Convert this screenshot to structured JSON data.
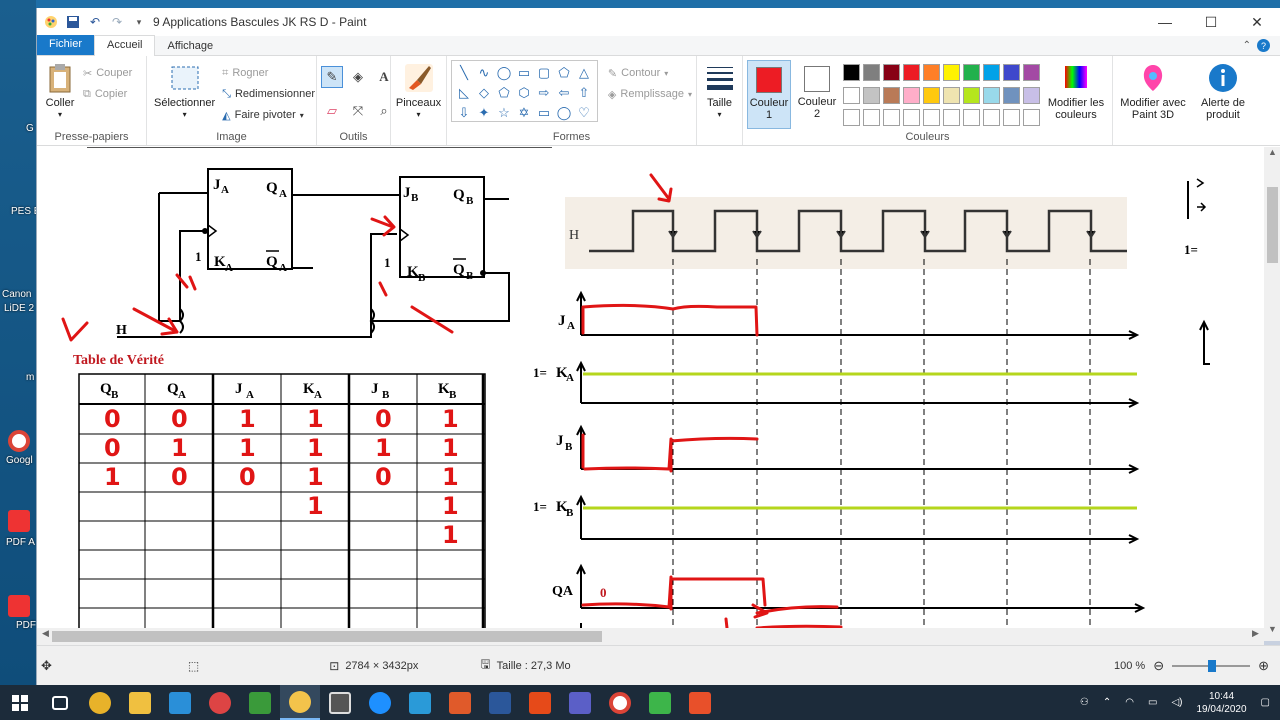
{
  "desktop": {
    "labels": [
      "G",
      "PES E",
      "Canon",
      "LiDE 2",
      "m",
      "Googl",
      "PDF A",
      "PDF"
    ]
  },
  "window": {
    "title": "9 Applications Bascules JK RS D - Paint",
    "controls": {
      "minimize": "—",
      "maximize": "☐",
      "close": "✕"
    }
  },
  "tabs": {
    "file": "Fichier",
    "home": "Accueil",
    "view": "Affichage"
  },
  "ribbon": {
    "clipboard": {
      "label": "Presse-papiers",
      "paste": "Coller",
      "cut": "Couper",
      "copy": "Copier"
    },
    "image": {
      "label": "Image",
      "select": "Sélectionner",
      "crop": "Rogner",
      "resize": "Redimensionner",
      "rotate": "Faire pivoter"
    },
    "tools": {
      "label": "Outils"
    },
    "brushes": {
      "label": "Pinceaux"
    },
    "shapes": {
      "label": "Formes",
      "outline": "Contour",
      "fill": "Remplissage"
    },
    "size": {
      "label": "Taille"
    },
    "colors": {
      "label": "Couleurs",
      "color1": "Couleur 1",
      "color2": "Couleur 2",
      "edit": "Modifier les couleurs",
      "color1_value": "#ed1c24",
      "color2_value": "#ffffff",
      "palette": [
        "#000000",
        "#7f7f7f",
        "#880015",
        "#ed1c24",
        "#ff7f27",
        "#fff200",
        "#22b14c",
        "#00a2e8",
        "#3f48cc",
        "#a349a4",
        "#ffffff",
        "#c3c3c3",
        "#b97a57",
        "#ffaec9",
        "#ffc90e",
        "#efe4b0",
        "#b5e61d",
        "#99d9ea",
        "#7092be",
        "#c8bfe7",
        "#ffffff",
        "#ffffff",
        "#ffffff",
        "#ffffff",
        "#ffffff",
        "#ffffff",
        "#ffffff",
        "#ffffff",
        "#ffffff",
        "#ffffff"
      ]
    },
    "paint3d": {
      "label": "Modifier avec Paint 3D"
    },
    "product_alert": {
      "label": "Alerte de produit"
    }
  },
  "drawing": {
    "circuit": {
      "ff_a": {
        "j": "J",
        "j_sub": "A",
        "k": "K",
        "k_sub": "A",
        "q": "Q",
        "q_sub": "A",
        "qbar": "Q",
        "qbar_sub": "A",
        "one": "1"
      },
      "ff_b": {
        "j": "J",
        "j_sub": "B",
        "k": "K",
        "k_sub": "B",
        "q": "Q",
        "q_sub": "B",
        "qbar": "Q",
        "qbar_sub": "B",
        "one": "1"
      },
      "clock": "H"
    },
    "truth_table": {
      "title": "Table de Vérité",
      "headers": [
        {
          "main": "Q",
          "sub": "B"
        },
        {
          "main": "Q",
          "sub": "A"
        },
        {
          "main": "J",
          "sub": "A"
        },
        {
          "main": "K",
          "sub": "A"
        },
        {
          "main": "J",
          "sub": "B"
        },
        {
          "main": "K",
          "sub": "B"
        }
      ],
      "rows": [
        [
          "0",
          "0",
          "1",
          "1",
          "0",
          "1"
        ],
        [
          "0",
          "1",
          "1",
          "1",
          "1",
          "1"
        ],
        [
          "1",
          "0",
          "0",
          "1",
          "0",
          "1"
        ],
        [
          "",
          "",
          "",
          "1",
          "",
          "1"
        ],
        [
          "",
          "",
          "",
          "",
          "",
          "1"
        ],
        [
          "",
          "",
          "",
          "",
          "",
          ""
        ],
        [
          "",
          "",
          "",
          "",
          "",
          ""
        ],
        [
          "",
          "",
          "",
          "",
          "",
          ""
        ]
      ]
    },
    "timing": {
      "clock_label": "H",
      "rows": [
        {
          "label": "J",
          "sub": "A",
          "prefix": ""
        },
        {
          "label": "K",
          "sub": "A",
          "prefix": "1="
        },
        {
          "label": "J",
          "sub": "B",
          "prefix": ""
        },
        {
          "label": "K",
          "sub": "B",
          "prefix": "1="
        },
        {
          "label": "QA",
          "sub": "",
          "prefix": ""
        }
      ],
      "qa_initial": "0",
      "qa_annotation": "1"
    },
    "side_panel": {
      "text": "1="
    }
  },
  "status": {
    "dimensions": "2784 × 3432px",
    "size": "Taille : 27,3 Mo",
    "zoom": "100 %"
  },
  "taskbar": {
    "time": "10:44",
    "date": "19/04/2020"
  }
}
